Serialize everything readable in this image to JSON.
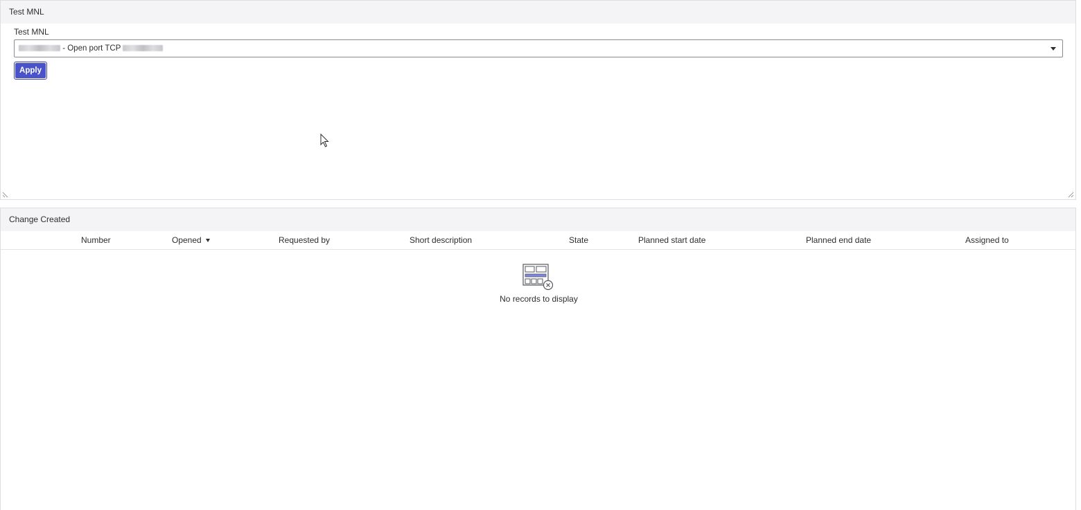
{
  "top_panel": {
    "title": "Test MNL",
    "field_label": "Test MNL",
    "select_value_text": "- Open port TCP",
    "apply_label": "Apply"
  },
  "bottom_panel": {
    "title": "Change Created",
    "columns": {
      "number": "Number",
      "opened": "Opened",
      "requested_by": "Requested by",
      "short_description": "Short description",
      "state": "State",
      "planned_start": "Planned start date",
      "planned_end": "Planned end date",
      "assigned_to": "Assigned to"
    },
    "empty_text": "No records to display"
  },
  "icons": {
    "dropdown": "chevron-down-icon",
    "sort": "sort-descending-icon",
    "empty": "no-records-icon",
    "resize": "resize-handle-icon",
    "cursor": "mouse-pointer-icon"
  },
  "colors": {
    "accent": "#4a52c9",
    "header_bg": "#f4f4f6",
    "border": "#dcdde0"
  }
}
